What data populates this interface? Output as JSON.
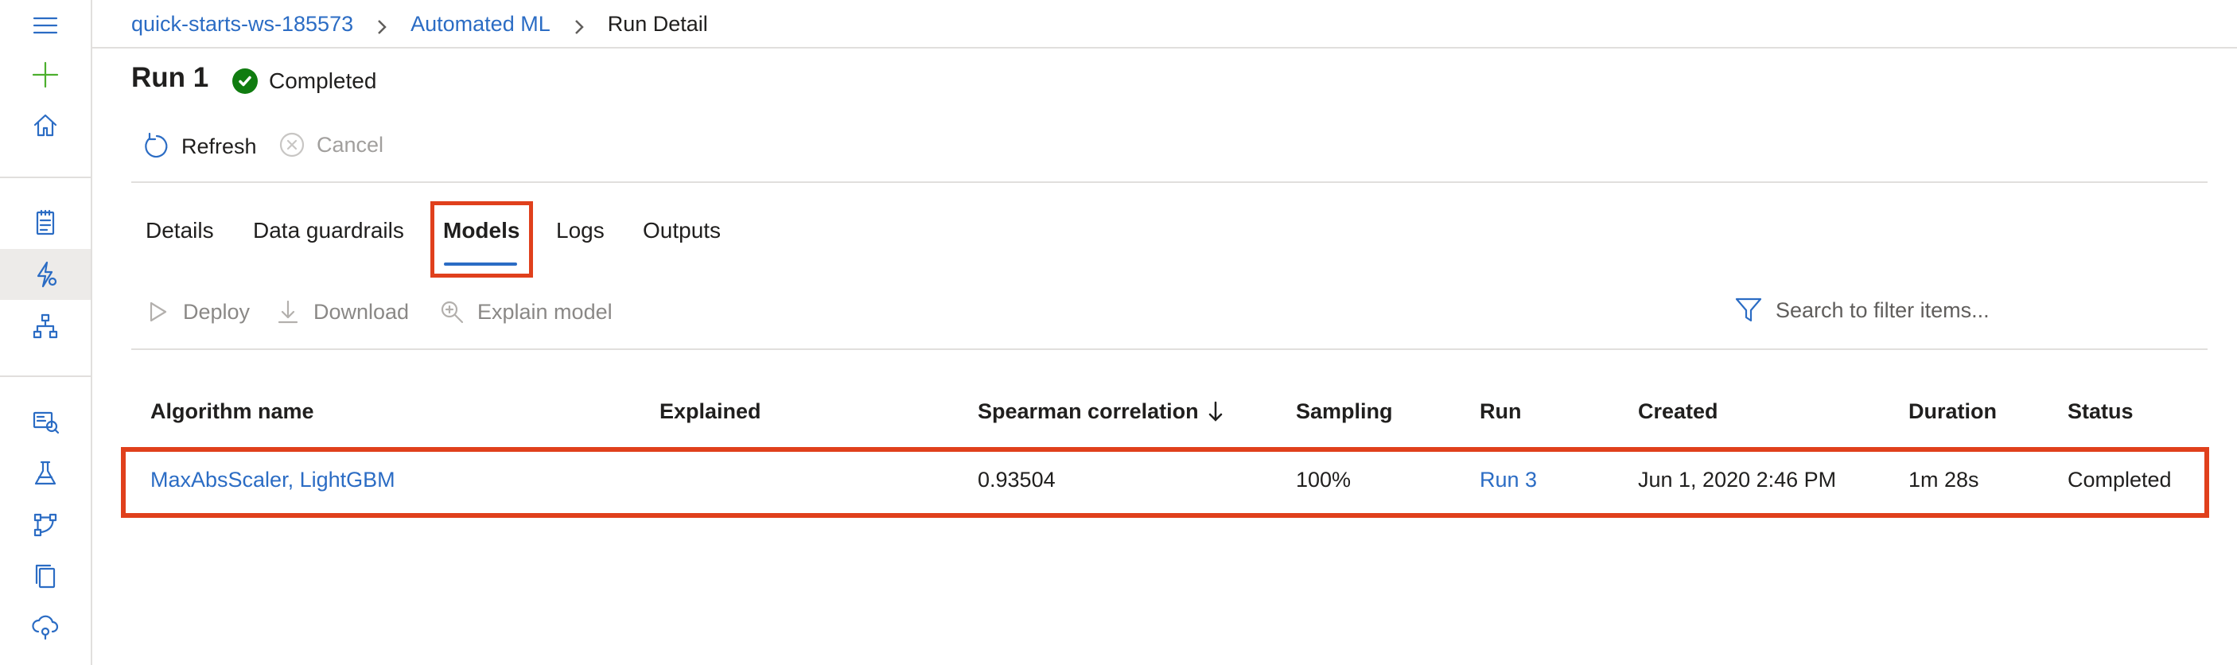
{
  "breadcrumb": {
    "workspace": "quick-starts-ws-185573",
    "section": "Automated ML",
    "current": "Run Detail"
  },
  "run": {
    "title": "Run 1",
    "status": "Completed"
  },
  "actions": {
    "refresh": "Refresh",
    "cancel": "Cancel"
  },
  "tabs": [
    {
      "label": "Details"
    },
    {
      "label": "Data guardrails"
    },
    {
      "label": "Models",
      "selected": true
    },
    {
      "label": "Logs"
    },
    {
      "label": "Outputs"
    }
  ],
  "model_actions": {
    "deploy": "Deploy",
    "download": "Download",
    "explain": "Explain model"
  },
  "search": {
    "placeholder": "Search to filter items..."
  },
  "table": {
    "columns": [
      "Algorithm name",
      "Explained",
      "Spearman correlation",
      "Sampling",
      "Run",
      "Created",
      "Duration",
      "Status"
    ],
    "sort_column": "Spearman correlation",
    "sort_direction": "descending",
    "rows": [
      {
        "algorithm": "MaxAbsScaler, LightGBM",
        "explained": "",
        "spearman": "0.93504",
        "sampling": "100%",
        "run": "Run 3",
        "created": "Jun 1, 2020 2:46 PM",
        "duration": "1m 28s",
        "status": "Completed"
      }
    ]
  },
  "colors": {
    "accent": "#2b6cc4",
    "success": "#107c10",
    "highlight": "#e0401c"
  },
  "icons": [
    "hamburger-menu-icon",
    "plus-icon",
    "home-icon",
    "notebook-icon",
    "automl-icon",
    "designer-icon",
    "datasets-icon",
    "experiments-icon",
    "pipelines-icon",
    "models-icon",
    "endpoints-icon",
    "check-circle-icon",
    "refresh-icon",
    "cancel-icon",
    "deploy-icon",
    "download-icon",
    "explain-icon",
    "filter-icon",
    "sort-down-arrow-icon"
  ]
}
